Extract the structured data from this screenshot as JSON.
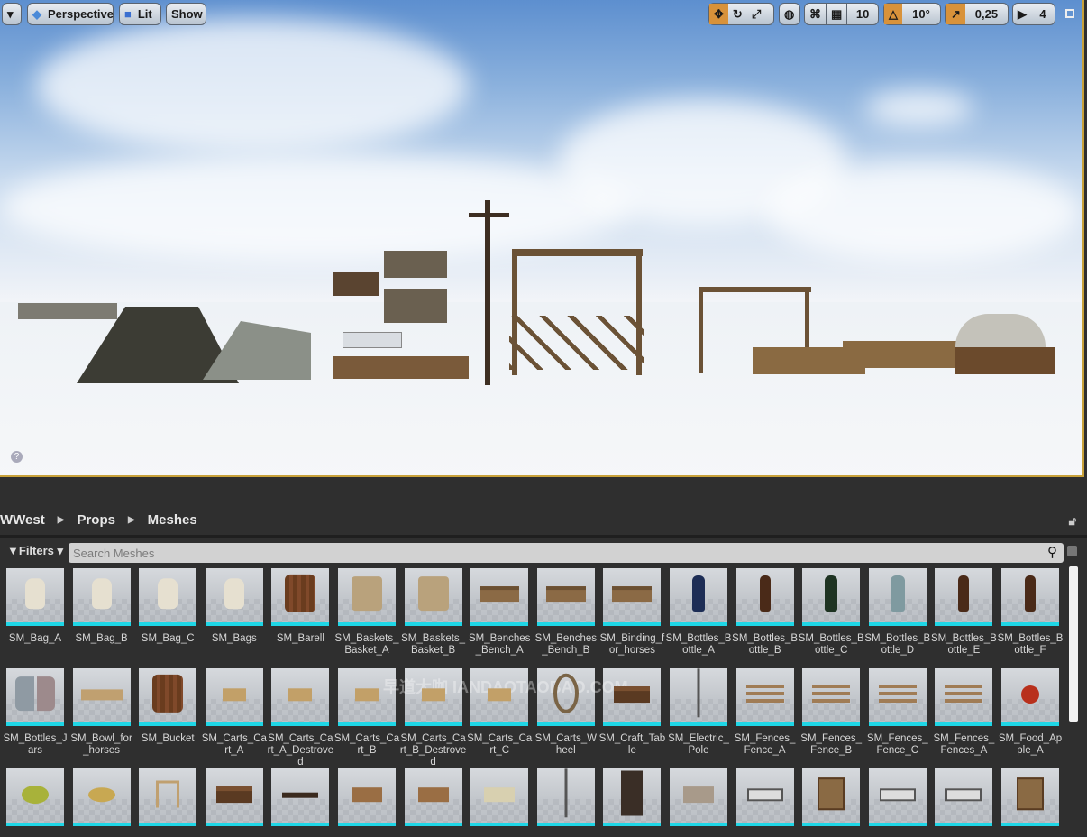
{
  "viewport": {
    "toolbar": {
      "perspective": "Perspective",
      "lit": "Lit",
      "show": "Show",
      "grid_snap": "10",
      "rotation_snap": "10°",
      "scale_snap": "0,25",
      "camera_speed": "4"
    },
    "help": "?"
  },
  "breadcrumb": [
    "WWest",
    "Props",
    "Meshes"
  ],
  "filters_label": "Filters",
  "search": {
    "placeholder": "Search Meshes",
    "value": ""
  },
  "accent": "#1ed6e6",
  "watermark": "早道大咖 IANDAOTAOBAO.COM",
  "assets": [
    {
      "name": "SM_Bag_A",
      "kind": "bag"
    },
    {
      "name": "SM_Bag_B",
      "kind": "bag"
    },
    {
      "name": "SM_Bag_C",
      "kind": "bag"
    },
    {
      "name": "SM_Bags",
      "kind": "bag"
    },
    {
      "name": "SM_Barell",
      "kind": "barrel"
    },
    {
      "name": "SM_Baskets_Basket_A",
      "kind": "basket"
    },
    {
      "name": "SM_Baskets_Basket_B",
      "kind": "basket"
    },
    {
      "name": "SM_Benches_Bench_A",
      "kind": "bench"
    },
    {
      "name": "SM_Benches_Bench_B",
      "kind": "bench"
    },
    {
      "name": "SM_Binding_for_horses",
      "kind": "bench"
    },
    {
      "name": "SM_Bottles_Bottle_A",
      "kind": "bottle-blue"
    },
    {
      "name": "SM_Bottles_Bottle_B",
      "kind": "bottle"
    },
    {
      "name": "SM_Bottles_Bottle_C",
      "kind": "bottle-green"
    },
    {
      "name": "SM_Bottles_Bottle_D",
      "kind": "bottle-teal"
    },
    {
      "name": "SM_Bottles_Bottle_E",
      "kind": "bottle"
    },
    {
      "name": "SM_Bottles_Bottle_F",
      "kind": "bottle"
    },
    {
      "name": "SM_Bottles_Jars",
      "kind": "jar"
    },
    {
      "name": "SM_Bowl_for_horses",
      "kind": "trough"
    },
    {
      "name": "SM_Bucket",
      "kind": "barrel"
    },
    {
      "name": "SM_Carts_Cart_A",
      "kind": "cart"
    },
    {
      "name": "SM_Carts_Cart_A_Destroved",
      "kind": "cart"
    },
    {
      "name": "SM_Carts_Cart_B",
      "kind": "cart"
    },
    {
      "name": "SM_Carts_Cart_B_Destroved",
      "kind": "cart"
    },
    {
      "name": "SM_Carts_Cart_C",
      "kind": "cart"
    },
    {
      "name": "SM_Carts_Wheel",
      "kind": "wheel"
    },
    {
      "name": "SM_Craft_Table",
      "kind": "table"
    },
    {
      "name": "SM_Electric_Pole",
      "kind": "pole"
    },
    {
      "name": "SM_Fences_Fence_A",
      "kind": "fence"
    },
    {
      "name": "SM_Fences_Fence_B",
      "kind": "fence"
    },
    {
      "name": "SM_Fences_Fence_C",
      "kind": "fence"
    },
    {
      "name": "SM_Fences_Fences_A",
      "kind": "fence"
    },
    {
      "name": "SM_Food_Apple_A",
      "kind": "apple"
    },
    {
      "name": "",
      "kind": "pear"
    },
    {
      "name": "",
      "kind": "potato"
    },
    {
      "name": "",
      "kind": "chair"
    },
    {
      "name": "",
      "kind": "table"
    },
    {
      "name": "",
      "kind": "gun"
    },
    {
      "name": "",
      "kind": "box"
    },
    {
      "name": "",
      "kind": "box"
    },
    {
      "name": "",
      "kind": "box-light"
    },
    {
      "name": "",
      "kind": "pole"
    },
    {
      "name": "",
      "kind": "shelf"
    },
    {
      "name": "",
      "kind": "planks"
    },
    {
      "name": "",
      "kind": "sign"
    },
    {
      "name": "",
      "kind": "sign-board"
    },
    {
      "name": "",
      "kind": "sign"
    },
    {
      "name": "",
      "kind": "sign"
    },
    {
      "name": "",
      "kind": "sign-board"
    }
  ]
}
